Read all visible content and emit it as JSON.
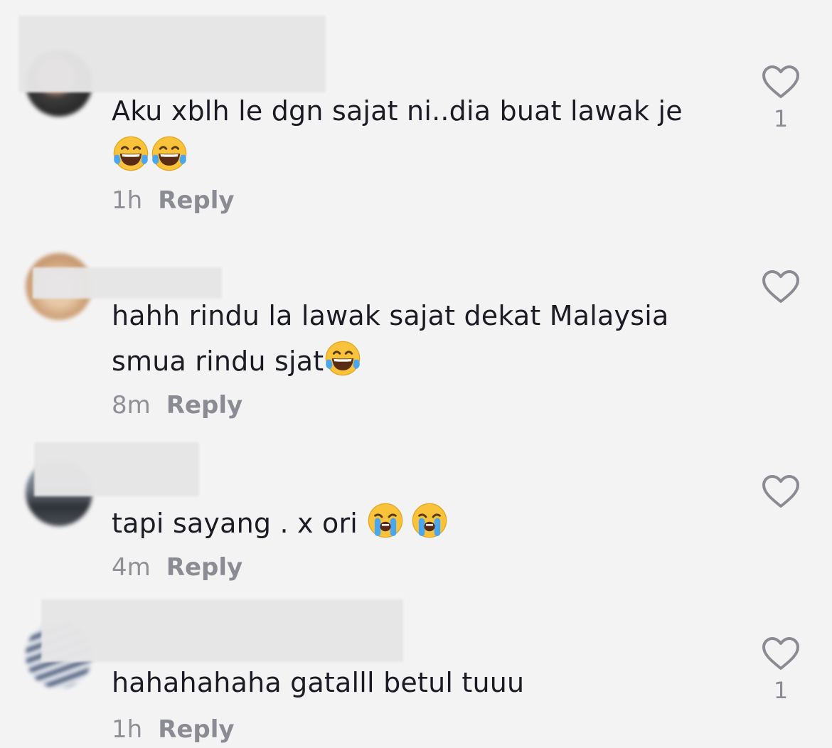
{
  "comments": [
    {
      "text_lines": [
        "Aku xblh le dgn sajat ni..dia buat lawak je"
      ],
      "emoji_line": [
        "face-with-tears-of-joy",
        "face-with-tears-of-joy"
      ],
      "time": "1h",
      "reply_label": "Reply",
      "like_count": "1"
    },
    {
      "text_lines": [
        "hahh rindu la lawak sajat dekat Malaysia",
        "smua rindu sjat"
      ],
      "trailing_emoji": [
        "face-with-tears-of-joy"
      ],
      "time": "8m",
      "reply_label": "Reply",
      "like_count": ""
    },
    {
      "text_lines": [
        "tapi sayang . x ori "
      ],
      "trailing_emoji": [
        "loudly-crying-face",
        "loudly-crying-face"
      ],
      "time": "4m",
      "reply_label": "Reply",
      "like_count": ""
    },
    {
      "text_lines": [
        "hahahahaha gatalll betul tuuu"
      ],
      "time": "1h",
      "reply_label": "Reply",
      "like_count": "1"
    }
  ],
  "icons": {
    "like": "heart-outline-icon"
  },
  "colors": {
    "background": "#f4f3f4",
    "text": "#1b1b24",
    "meta": "#8f8f96",
    "heart": "#8b8b93"
  }
}
